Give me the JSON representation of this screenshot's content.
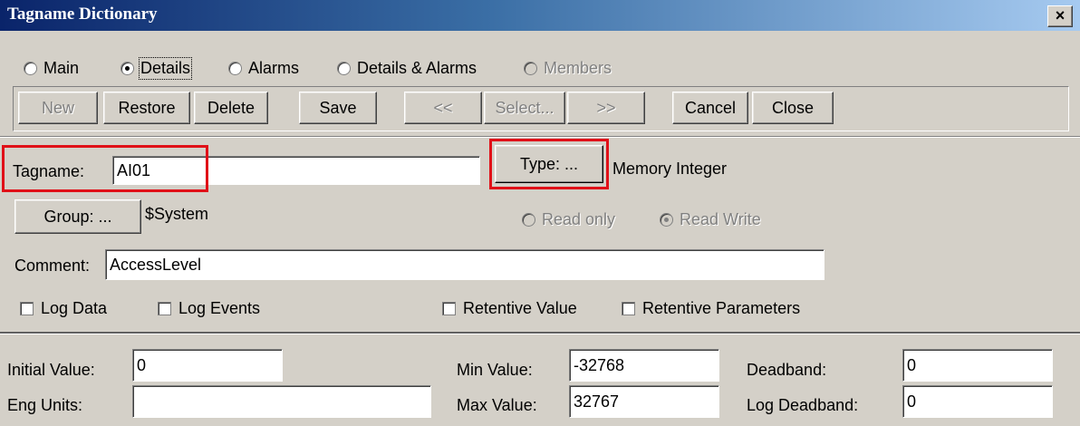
{
  "window": {
    "title": "Tagname Dictionary",
    "close_label": "×"
  },
  "view_tabs": [
    {
      "label": "Main",
      "selected": false,
      "enabled": true
    },
    {
      "label": "Details",
      "selected": true,
      "enabled": true
    },
    {
      "label": "Alarms",
      "selected": false,
      "enabled": true
    },
    {
      "label": "Details & Alarms",
      "selected": false,
      "enabled": true
    },
    {
      "label": "Members",
      "selected": false,
      "enabled": false
    }
  ],
  "toolbar": {
    "new": "New",
    "restore": "Restore",
    "delete": "Delete",
    "save": "Save",
    "prev": "<<",
    "select": "Select...",
    "next": ">>",
    "cancel": "Cancel",
    "close": "Close"
  },
  "tag": {
    "tagname_label": "Tagname:",
    "tagname_value": "AI01",
    "type_button": "Type: ...",
    "type_value": "Memory Integer",
    "group_button": "Group: ...",
    "group_value": "$System",
    "read_only": "Read only",
    "read_write": "Read Write",
    "comment_label": "Comment:",
    "comment_value": "AccessLevel"
  },
  "options": {
    "log_data": "Log Data",
    "log_events": "Log Events",
    "retentive_value": "Retentive Value",
    "retentive_parameters": "Retentive Parameters"
  },
  "values": {
    "initial_value_label": "Initial Value:",
    "initial_value": "0",
    "eng_units_label": "Eng Units:",
    "eng_units": "",
    "min_value_label": "Min Value:",
    "min_value": "-32768",
    "max_value_label": "Max Value:",
    "max_value": "32767",
    "deadband_label": "Deadband:",
    "deadband": "0",
    "log_deadband_label": "Log Deadband:",
    "log_deadband": "0"
  },
  "colors": {
    "highlight": "#e01018",
    "titlebar": "#0a246a",
    "face": "#d4d0c8"
  }
}
